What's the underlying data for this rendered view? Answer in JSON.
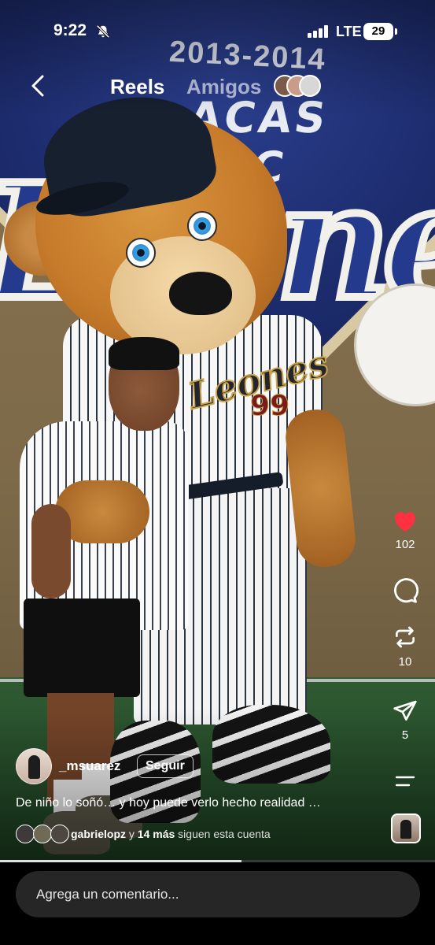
{
  "status_bar": {
    "time": "9:22",
    "network": "LTE",
    "battery": "29",
    "icons": [
      "bell-muted-icon",
      "signal-icon",
      "battery-icon"
    ]
  },
  "header": {
    "back_icon": "chevron-left-icon",
    "tabs": [
      {
        "label": "Reels",
        "active": true
      },
      {
        "label": "Amigos",
        "active": false
      }
    ]
  },
  "actions": {
    "like": {
      "icon": "heart-filled-icon",
      "count": "102",
      "color": "#ff3040"
    },
    "comment": {
      "icon": "comment-icon"
    },
    "repost": {
      "icon": "repost-icon",
      "count": "10"
    },
    "share": {
      "icon": "send-icon",
      "count": "5"
    },
    "more": {
      "icon": "more-lines-icon"
    }
  },
  "post": {
    "username": "_msuarez",
    "follow_label": "Seguir",
    "caption": "De niño lo soñó… y hoy puede verlo hecho realidad …",
    "followed_by": {
      "user": "gabrielopz",
      "connector": "y",
      "others": "14 más",
      "suffix": "siguen esta cuenta"
    }
  },
  "photo_text": {
    "years": "2013-2014",
    "club": "ACAS BBC",
    "script": "Leones",
    "jersey_word": "Leones",
    "jersey_number": "99"
  },
  "progress": 0.555,
  "comment_box": {
    "placeholder": "Agrega un comentario..."
  }
}
